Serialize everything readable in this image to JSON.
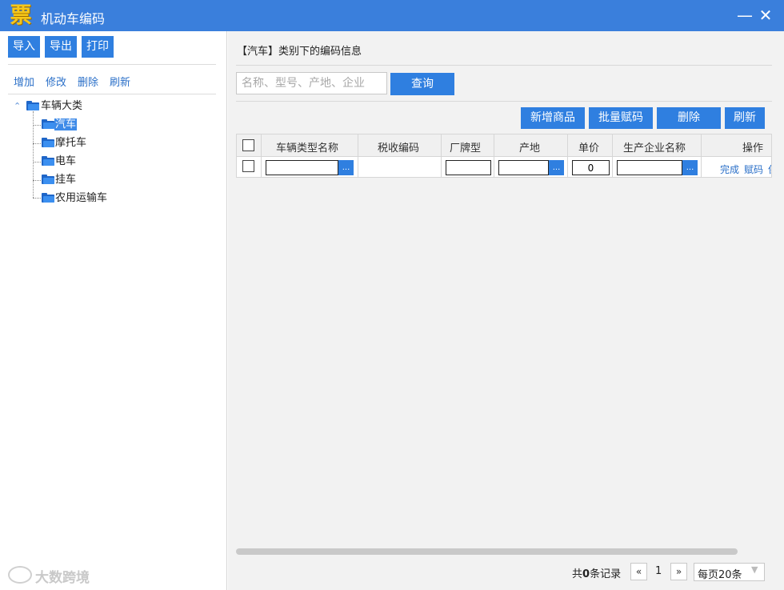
{
  "window": {
    "logo_char": "票",
    "title": "机动车编码",
    "min_glyph": "—",
    "close_glyph": "✕"
  },
  "left": {
    "toolbar": {
      "import": "导入",
      "export": "导出",
      "print": "打印"
    },
    "links": {
      "add": "增加",
      "edit": "修改",
      "delete": "删除",
      "refresh": "刷新"
    },
    "tree": {
      "expander_glyph": "⌃",
      "root": "车辆大类",
      "children": [
        "汽车",
        "摩托车",
        "电车",
        "挂车",
        "农用运输车"
      ]
    },
    "watermark": "大数跨境"
  },
  "right": {
    "section_title": "【汽车】类别下的编码信息",
    "search": {
      "placeholder": "名称、型号、产地、企业",
      "button": "查询"
    },
    "actions": {
      "new_item": "新增商品",
      "batch_code": "批量赋码",
      "delete": "删除",
      "refresh": "刷新"
    },
    "grid": {
      "headers": {
        "name": "车辆类型名称",
        "tax_code": "税收编码",
        "model": "厂牌型",
        "origin": "产地",
        "price": "单价",
        "maker": "生产企业名称",
        "ops": "操作"
      },
      "row": {
        "price": "0",
        "picker_glyph": "...",
        "op_done": "完成",
        "op_code": "赋码",
        "op_more": "保存"
      }
    },
    "pager": {
      "prefix": "共",
      "count": "0",
      "suffix": "条记录",
      "prev": "«",
      "page": "1",
      "next": "»",
      "page_size": "每页20条",
      "dropdown_glyph": "▼"
    }
  }
}
